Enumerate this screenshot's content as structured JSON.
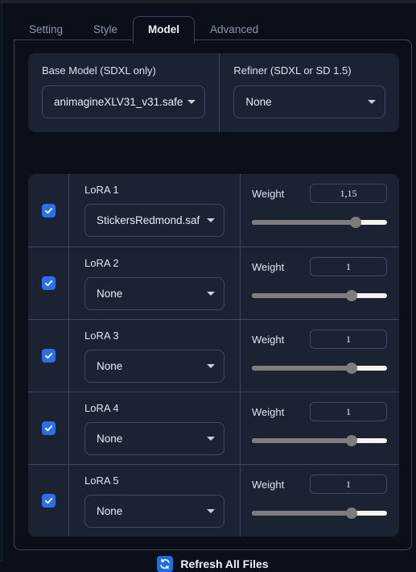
{
  "tabs": [
    {
      "label": "Setting",
      "active": false
    },
    {
      "label": "Style",
      "active": false
    },
    {
      "label": "Model",
      "active": true
    },
    {
      "label": "Advanced",
      "active": false
    }
  ],
  "model_panel": {
    "base_model": {
      "label": "Base Model (SDXL only)",
      "value": "animagineXLV31_v31.safe"
    },
    "refiner": {
      "label": "Refiner (SDXL or SD 1.5)",
      "value": "None"
    },
    "weight_label": "Weight",
    "loras": [
      {
        "title": "LoRA 1",
        "enabled": true,
        "model": "StickersRedmond.saf",
        "weight": "1,15",
        "slider_pct": 77
      },
      {
        "title": "LoRA 2",
        "enabled": true,
        "model": "None",
        "weight": "1",
        "slider_pct": 74
      },
      {
        "title": "LoRA 3",
        "enabled": true,
        "model": "None",
        "weight": "1",
        "slider_pct": 74
      },
      {
        "title": "LoRA 4",
        "enabled": true,
        "model": "None",
        "weight": "1",
        "slider_pct": 74
      },
      {
        "title": "LoRA 5",
        "enabled": true,
        "model": "None",
        "weight": "1",
        "slider_pct": 74
      }
    ],
    "refresh_button": {
      "label": "Refresh All Files",
      "icon": "refresh-icon"
    }
  },
  "colors": {
    "page_bg": "#0b0f19",
    "card_bg": "#1b2231",
    "border": "#39465c",
    "accent": "#2d6fe8",
    "text": "#e7edf6",
    "muted_text": "#8b97ab"
  }
}
